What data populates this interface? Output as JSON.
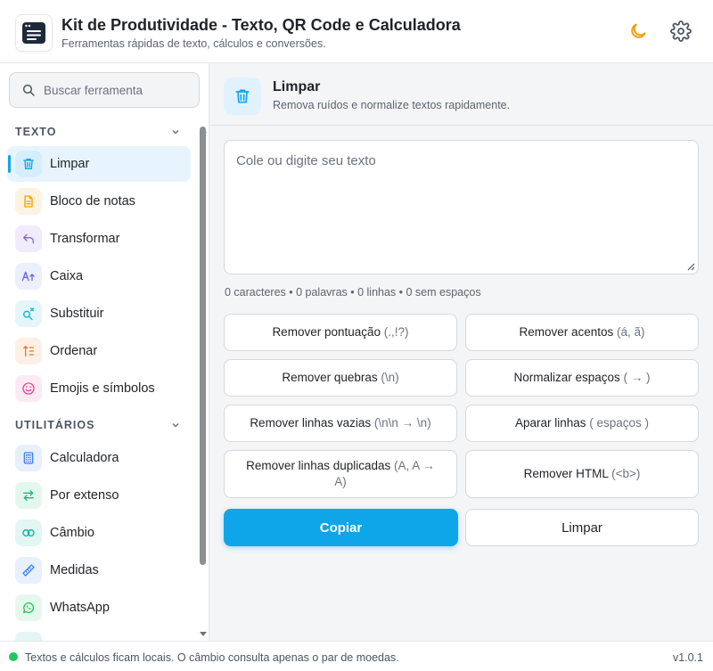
{
  "header": {
    "title": "Kit de Produtividade - Texto, QR Code e Calculadora",
    "subtitle": "Ferramentas rápidas de texto, cálculos e conversões.",
    "theme_icon": "moon-icon",
    "settings_icon": "gear-icon"
  },
  "sidebar": {
    "search": {
      "placeholder": "Buscar ferramenta",
      "value": ""
    },
    "sections": [
      {
        "label": "TEXTO",
        "items": [
          {
            "label": "Limpar",
            "icon": "trash-icon",
            "color": "#0ea5e9",
            "active": true
          },
          {
            "label": "Bloco de notas",
            "icon": "notepad-icon",
            "color": "#f59e0b"
          },
          {
            "label": "Transformar",
            "icon": "undo-arrow-icon",
            "color": "#8b5cf6"
          },
          {
            "label": "Caixa",
            "icon": "text-case-icon",
            "color": "#6366f1"
          },
          {
            "label": "Substituir",
            "icon": "search-replace-icon",
            "color": "#06b6d4"
          },
          {
            "label": "Ordenar",
            "icon": "sort-icon",
            "color": "#f97316"
          },
          {
            "label": "Emojis e símbolos",
            "icon": "smiley-icon",
            "color": "#ec4899"
          }
        ]
      },
      {
        "label": "UTILITÁRIOS",
        "items": [
          {
            "label": "Calculadora",
            "icon": "calculator-icon",
            "color": "#3b82f6"
          },
          {
            "label": "Por extenso",
            "icon": "swap-arrows-icon",
            "color": "#10b981"
          },
          {
            "label": "Câmbio",
            "icon": "currency-exchange-icon",
            "color": "#14b8a6"
          },
          {
            "label": "Medidas",
            "icon": "ruler-icon",
            "color": "#3b82f6"
          },
          {
            "label": "WhatsApp",
            "icon": "whatsapp-icon",
            "color": "#22c55e"
          }
        ]
      }
    ]
  },
  "tool": {
    "title": "Limpar",
    "subtitle": "Remova ruídos e normalize textos rapidamente.",
    "icon": "trash-icon",
    "textarea": {
      "placeholder": "Cole ou digite seu texto",
      "value": ""
    },
    "stats": "0 caracteres • 0 palavras • 0 linhas • 0 sem espaços",
    "operations": [
      {
        "label": "Remover pontuação",
        "hint": "(.,!?)"
      },
      {
        "label": "Remover acentos",
        "hint": "(á, ã)"
      },
      {
        "label": "Remover quebras",
        "hint": "(\\n)"
      },
      {
        "label": "Normalizar espaços",
        "hint": "( → )"
      },
      {
        "label": "Remover linhas vazias",
        "hint": "(\\n\\n → \\n)"
      },
      {
        "label": "Aparar linhas",
        "hint": "( espaços )"
      },
      {
        "label": "Remover linhas duplicadas",
        "hint": "(A, A → A)"
      },
      {
        "label": "Remover HTML",
        "hint": "(<b>)"
      }
    ],
    "copy_label": "Copiar",
    "clear_label": "Limpar"
  },
  "footer": {
    "status_text": "Textos e cálculos ficam locais. O câmbio consulta apenas o par de moedas.",
    "status_color": "#22c55e",
    "version": "v1.0.1"
  }
}
